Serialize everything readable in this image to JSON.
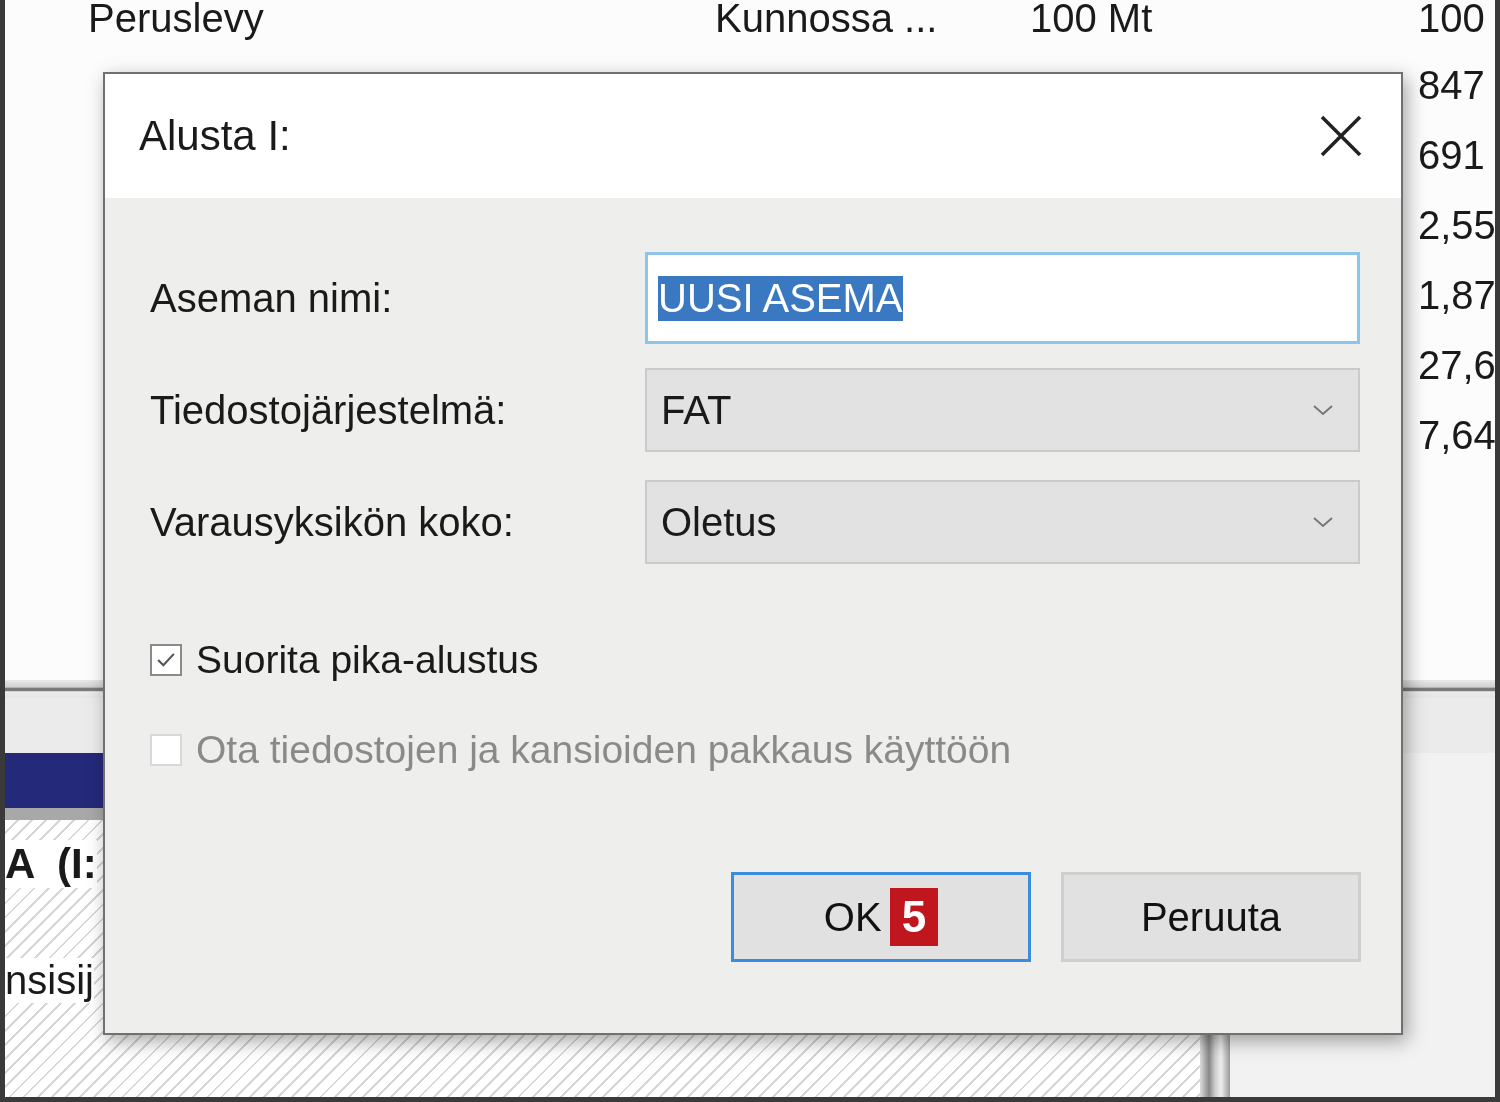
{
  "background": {
    "header_row": {
      "name": "Peruslevy",
      "status": "Kunnossa ...",
      "capacity": "100 Mt",
      "free": "100"
    },
    "right_column": [
      "847",
      "691",
      "2,55",
      "1,87",
      "27,6",
      "7,64"
    ],
    "volume_label": "A  (I:",
    "volume_text": "nsisij"
  },
  "dialog": {
    "title": "Alusta I:",
    "fields": [
      {
        "kind": "text",
        "label": "Aseman nimi:",
        "value": "UUSI ASEMA",
        "text_selected": true
      },
      {
        "kind": "select",
        "label": "Tiedostojärjestelmä:",
        "value": "FAT"
      },
      {
        "kind": "select",
        "label": "Varausyksikön koko:",
        "value": "Oletus"
      }
    ],
    "options": [
      {
        "label": "Suorita pika-alustus",
        "checked": true,
        "disabled": false
      },
      {
        "label": "Ota tiedostojen ja kansioiden pakkaus käyttöön",
        "checked": false,
        "disabled": true
      }
    ],
    "buttons": [
      {
        "label": "OK",
        "default": true,
        "badge": "5"
      },
      {
        "label": "Peruuta",
        "default": false
      }
    ]
  }
}
